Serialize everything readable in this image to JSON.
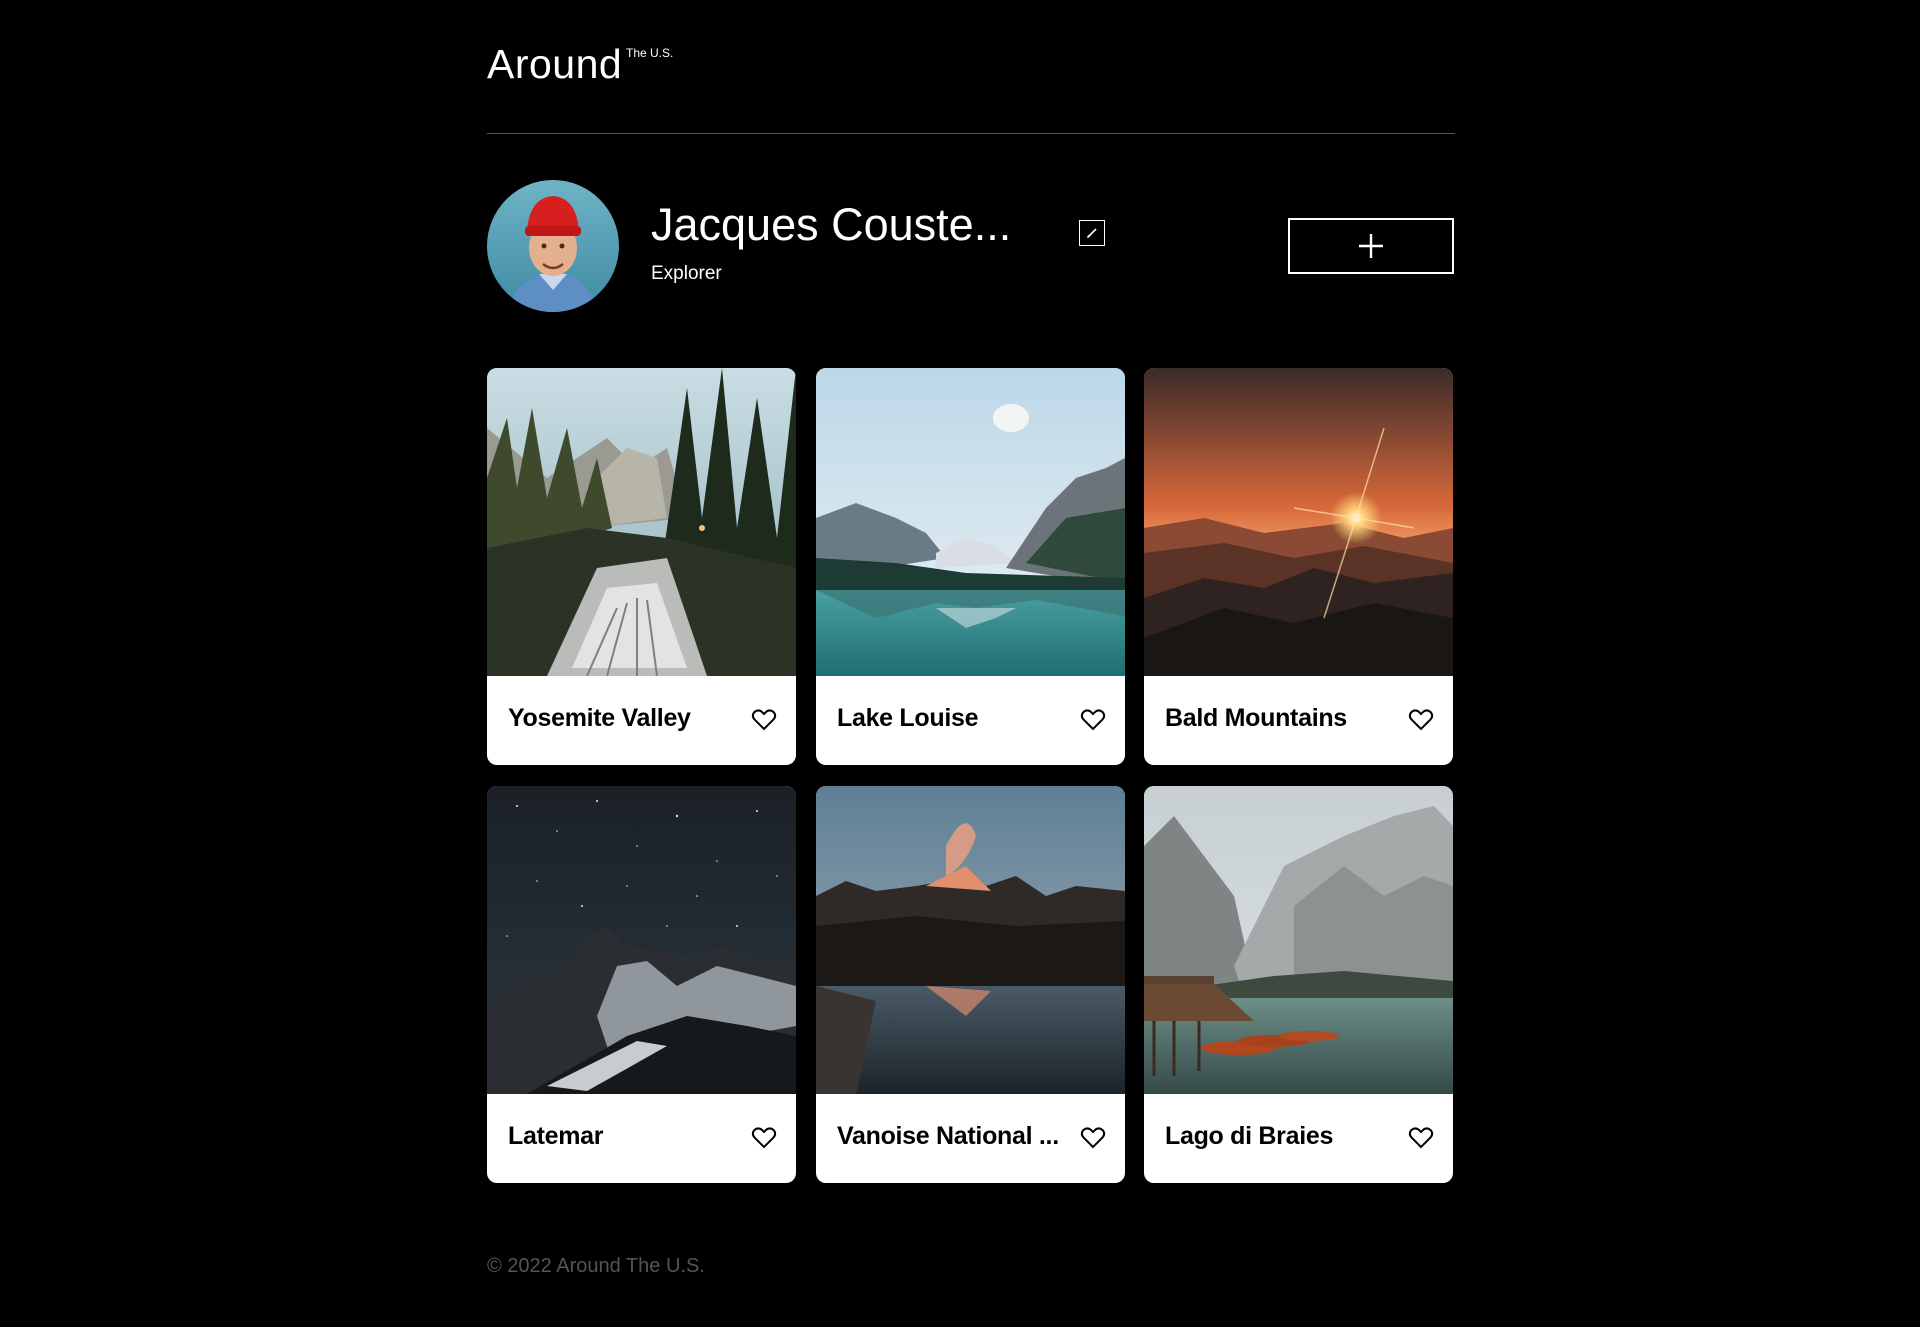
{
  "header": {
    "logo": "Around",
    "logo_superscript": "The U.S."
  },
  "profile": {
    "name": "Jacques Couste...",
    "about": "Explorer",
    "avatar_icon": "avatar-photo",
    "edit_icon": "pencil-icon",
    "add_icon": "plus-icon"
  },
  "cards": [
    {
      "title": "Yosemite Valley",
      "image": "forest-river-valley"
    },
    {
      "title": "Lake Louise",
      "image": "mountain-lake"
    },
    {
      "title": "Bald Mountains",
      "image": "sunset-mountains"
    },
    {
      "title": "Latemar",
      "image": "night-mountain-stars"
    },
    {
      "title": "Vanoise National ...",
      "image": "lake-reflection-mountains"
    },
    {
      "title": "Lago di Braies",
      "image": "lake-boats-cliffs"
    }
  ],
  "footer": {
    "copyright": "© 2022 Around The U.S."
  },
  "colors": {
    "background": "#000000",
    "divider": "#545454",
    "card": "#ffffff",
    "footer_text": "#545454"
  }
}
